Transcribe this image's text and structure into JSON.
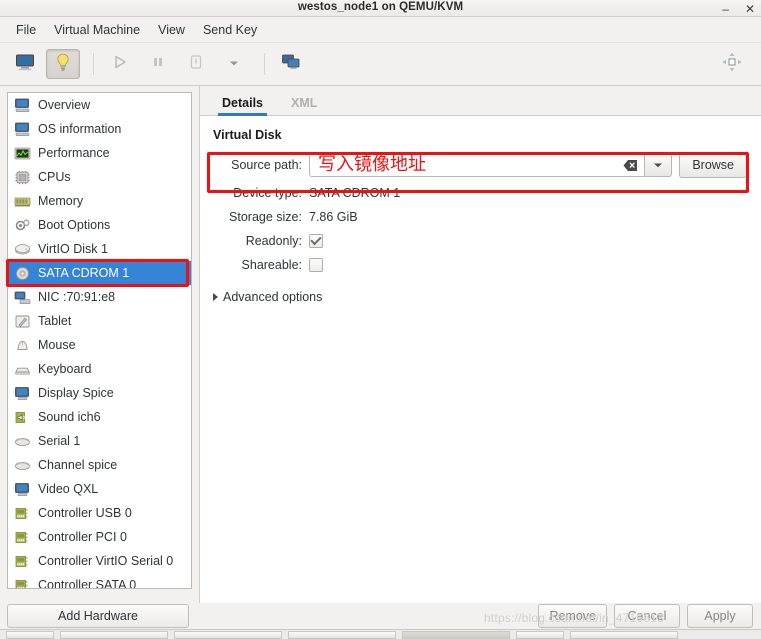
{
  "window": {
    "title": "westos_node1 on QEMU/KVM",
    "minimize_label": "–",
    "close_label": "✕"
  },
  "menubar": {
    "items": [
      {
        "label": "File",
        "name": "menu-file"
      },
      {
        "label": "Virtual Machine",
        "name": "menu-virtual-machine"
      },
      {
        "label": "View",
        "name": "menu-view"
      },
      {
        "label": "Send Key",
        "name": "menu-send-key"
      }
    ]
  },
  "toolbar": {
    "buttons": [
      {
        "icon": "console-monitor-icon",
        "pressed": false
      },
      {
        "icon": "lightbulb-show-details-icon",
        "pressed": true
      },
      {
        "icon": "play-run-icon",
        "pressed": false
      },
      {
        "icon": "pause-icon",
        "pressed": false
      },
      {
        "icon": "shutdown-icon",
        "pressed": false
      },
      {
        "icon": "chevron-down-icon",
        "pressed": false
      },
      {
        "icon": "snapshots-icon",
        "pressed": false
      }
    ],
    "fullscreen_icon": "fullscreen-expand-icon"
  },
  "sidebar": {
    "items": [
      {
        "label": "Overview",
        "icon": "computer-icon",
        "selected": false
      },
      {
        "label": "OS information",
        "icon": "computer-icon",
        "selected": false
      },
      {
        "label": "Performance",
        "icon": "performance-graph-icon",
        "selected": false
      },
      {
        "label": "CPUs",
        "icon": "cpu-chip-icon",
        "selected": false
      },
      {
        "label": "Memory",
        "icon": "memory-ram-icon",
        "selected": false
      },
      {
        "label": "Boot Options",
        "icon": "gears-icon",
        "selected": false
      },
      {
        "label": "VirtIO Disk 1",
        "icon": "disk-icon",
        "selected": false
      },
      {
        "label": "SATA CDROM 1",
        "icon": "cdrom-icon",
        "selected": true
      },
      {
        "label": "NIC :70:91:e8",
        "icon": "network-icon",
        "selected": false
      },
      {
        "label": "Tablet",
        "icon": "tablet-icon",
        "selected": false
      },
      {
        "label": "Mouse",
        "icon": "mouse-icon",
        "selected": false
      },
      {
        "label": "Keyboard",
        "icon": "keyboard-icon",
        "selected": false
      },
      {
        "label": "Display Spice",
        "icon": "display-icon",
        "selected": false
      },
      {
        "label": "Sound ich6",
        "icon": "sound-card-icon",
        "selected": false
      },
      {
        "label": "Serial 1",
        "icon": "serial-port-icon",
        "selected": false
      },
      {
        "label": "Channel spice",
        "icon": "channel-icon",
        "selected": false
      },
      {
        "label": "Video QXL",
        "icon": "video-icon",
        "selected": false
      },
      {
        "label": "Controller USB 0",
        "icon": "controller-card-icon",
        "selected": false
      },
      {
        "label": "Controller PCI 0",
        "icon": "controller-card-icon",
        "selected": false
      },
      {
        "label": "Controller VirtIO Serial 0",
        "icon": "controller-card-icon",
        "selected": false
      },
      {
        "label": "Controller SATA 0",
        "icon": "controller-card-icon",
        "selected": false
      }
    ],
    "add_hardware_label": "Add Hardware"
  },
  "panel": {
    "tabs": [
      {
        "label": "Details",
        "active": true
      },
      {
        "label": "XML",
        "active": false
      }
    ],
    "section_title": "Virtual Disk",
    "fields": {
      "source_path_label": "Source path:",
      "source_path_value": "写入镜像地址",
      "source_path_placeholder": "写入镜像地址",
      "browse_label": "Browse",
      "device_type_label": "Device type:",
      "device_type_value": "SATA CDROM 1",
      "storage_size_label": "Storage size:",
      "storage_size_value": "7.86 GiB",
      "readonly_label": "Readonly:",
      "readonly_checked": true,
      "shareable_label": "Shareable:",
      "shareable_checked": false,
      "advanced_options_label": "Advanced options"
    }
  },
  "bottombar": {
    "add_hardware_label": "Add Hardware",
    "remove_label": "Remove",
    "cancel_label": "Cancel",
    "apply_label": "Apply"
  },
  "watermark": {
    "text": "https://blog.csdn.net/in_4716613"
  },
  "colors": {
    "selection_blue": "#3584d8",
    "annotation_red": "#f01010",
    "tab_underline": "#2d78c8",
    "entry_text_red": "#ee1111"
  }
}
